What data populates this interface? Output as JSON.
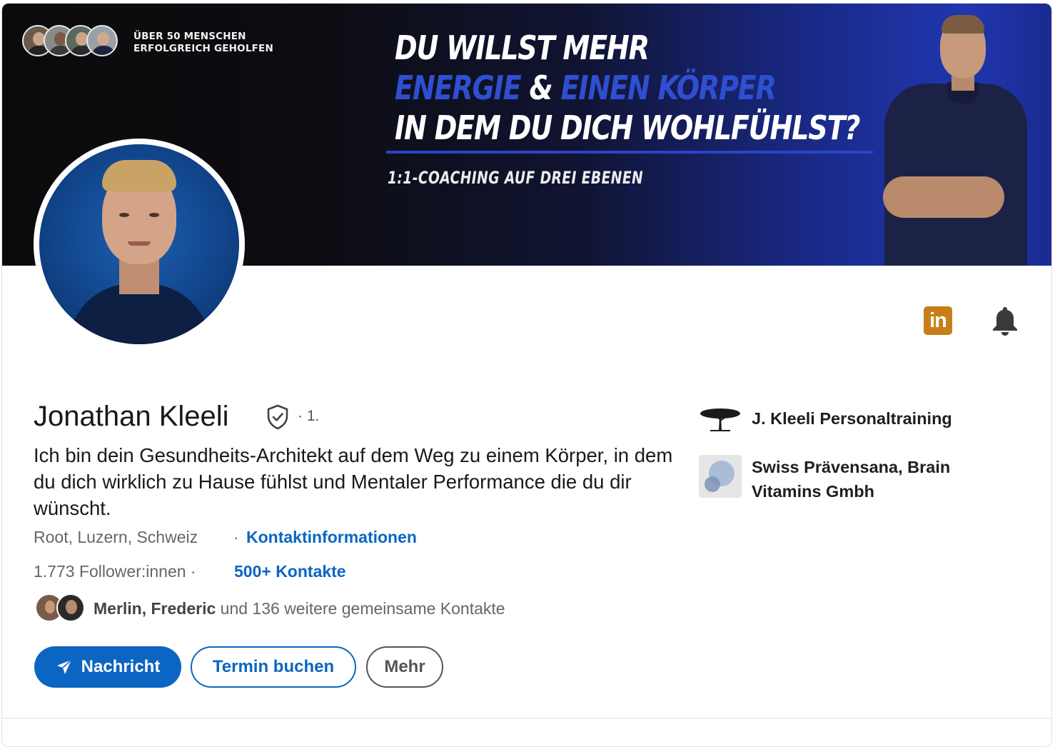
{
  "banner": {
    "badge_line1": "ÜBER 50 MENSCHEN",
    "badge_line2": "ERFOLGREICH GEHOLFEN",
    "headline_line1": "DU WILLST MEHR",
    "headline_blue1": "ENERGIE",
    "headline_amp": " & ",
    "headline_blue2": "EINEN KÖRPER",
    "headline_line3": "IN DEM DU DICH WOHLFÜHLST?",
    "subline": "1:1-COACHING AUF DREI EBENEN"
  },
  "profile": {
    "name": "Jonathan Kleeli",
    "degree": "· 1.",
    "headline": "Ich bin dein Gesundheits-Architekt auf dem Weg zu einem Körper, in dem du dich wirklich zu Hause fühlst und Mentaler Performance die du dir wünscht.",
    "location": "Root, Luzern, Schweiz",
    "location_sep": "·",
    "contact_info_label": "Kontaktinformationen",
    "followers": "1.773 Follower:innen ·",
    "contacts_label": "500+ Kontakte",
    "mutual_names": "Merlin, Frederic",
    "mutual_rest": " und 136 weitere gemeinsame Kontakte"
  },
  "actions": {
    "message_label": "Nachricht",
    "book_label": "Termin buchen",
    "more_label": "Mehr"
  },
  "icons": {
    "linkedin_text": "in",
    "linkedin_color": "#c77f18",
    "accent_blue": "#0a66c2"
  },
  "organizations": [
    {
      "name": "J. Kleeli Personaltraining"
    },
    {
      "name": "Swiss Prävensana, Brain Vitamins Gmbh"
    }
  ]
}
